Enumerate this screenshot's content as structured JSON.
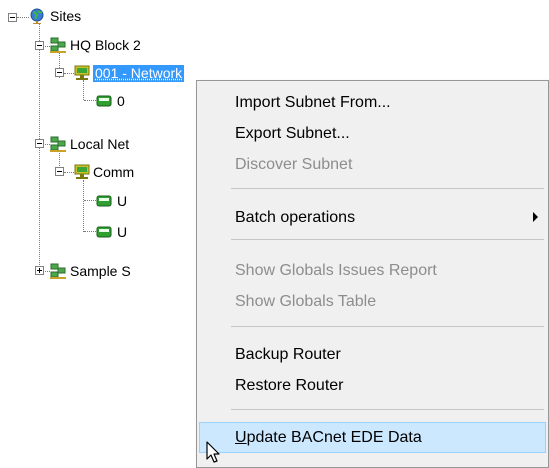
{
  "tree": {
    "root": {
      "label": "Sites",
      "icon": "globe-icon"
    },
    "nodes": [
      {
        "label": "HQ Block 2",
        "icon": "network-group-icon"
      },
      {
        "label": "001 - Network",
        "icon": "network-icon",
        "selected": true
      },
      {
        "label": "0",
        "icon": "router-icon"
      },
      {
        "label": "Local Net",
        "icon": "network-group-icon"
      },
      {
        "label": "Comm",
        "icon": "network-icon"
      },
      {
        "label": "U",
        "icon": "router-icon"
      },
      {
        "label": "U",
        "icon": "router-icon"
      },
      {
        "label": "Sample S",
        "icon": "network-group-icon"
      }
    ]
  },
  "context_menu": {
    "import_subnet": "Import Subnet From...",
    "export_subnet": "Export Subnet...",
    "discover_subnet": "Discover Subnet",
    "batch_operations": "Batch operations",
    "show_globals_issues": "Show Globals Issues Report",
    "show_globals_table": "Show Globals Table",
    "backup_router": "Backup Router",
    "restore_router": "Restore Router",
    "update_bacnet_first": "U",
    "update_bacnet_rest": "pdate BACnet EDE Data"
  },
  "colors": {
    "selection": "#3399ff",
    "menu_highlight": "#cce8ff",
    "menu_background": "#f0f0f0",
    "disabled_text": "#8d8d8d"
  }
}
